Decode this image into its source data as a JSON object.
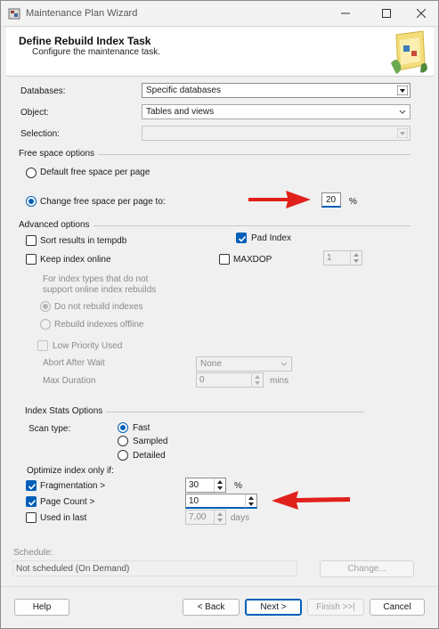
{
  "window": {
    "title": "Maintenance Plan Wizard"
  },
  "header": {
    "title": "Define Rebuild Index Task",
    "subtitle": "Configure the maintenance task."
  },
  "form": {
    "databases_label": "Databases:",
    "databases_value": "Specific databases",
    "object_label": "Object:",
    "object_value": "Tables and views",
    "selection_label": "Selection:",
    "selection_value": ""
  },
  "free_space": {
    "section_label": "Free space options",
    "default_option": "Default free space per page",
    "change_option": "Change free space per page to:",
    "change_value": "20",
    "percent_unit": "%"
  },
  "advanced": {
    "section_label": "Advanced options",
    "sort_tempdb": "Sort results in tempdb",
    "pad_index": "Pad Index",
    "keep_online": "Keep index online",
    "maxdop": "MAXDOP",
    "maxdop_value": "1",
    "note_line1": "For index types that do not",
    "note_line2": "support online index rebuilds",
    "do_not_rebuild": "Do not rebuild indexes",
    "rebuild_offline": "Rebuild indexes offline",
    "low_priority": "Low Priority Used",
    "abort_after_wait_label": "Abort After Wait",
    "abort_after_wait_value": "None",
    "max_duration_label": "Max Duration",
    "max_duration_value": "0",
    "mins_unit": "mins"
  },
  "index_stats": {
    "section_label": "Index Stats Options",
    "scan_type_label": "Scan type:",
    "fast": "Fast",
    "sampled": "Sampled",
    "detailed": "Detailed"
  },
  "optimize": {
    "label": "Optimize index only if:",
    "fragmentation_label": "Fragmentation >",
    "fragmentation_value": "30",
    "fragmentation_unit": "%",
    "page_count_label": "Page Count >",
    "page_count_value": "10",
    "used_in_last_label": "Used  in last",
    "used_in_last_value": "7,00",
    "days_unit": "days"
  },
  "schedule": {
    "label": "Schedule:",
    "value": "Not scheduled (On Demand)",
    "change_button": "Change..."
  },
  "buttons": {
    "help": "Help",
    "back": "< Back",
    "next": "Next >",
    "finish": "Finish >>|",
    "cancel": "Cancel"
  },
  "colors": {
    "accent": "#005fb8",
    "arrow": "#e0201b"
  }
}
